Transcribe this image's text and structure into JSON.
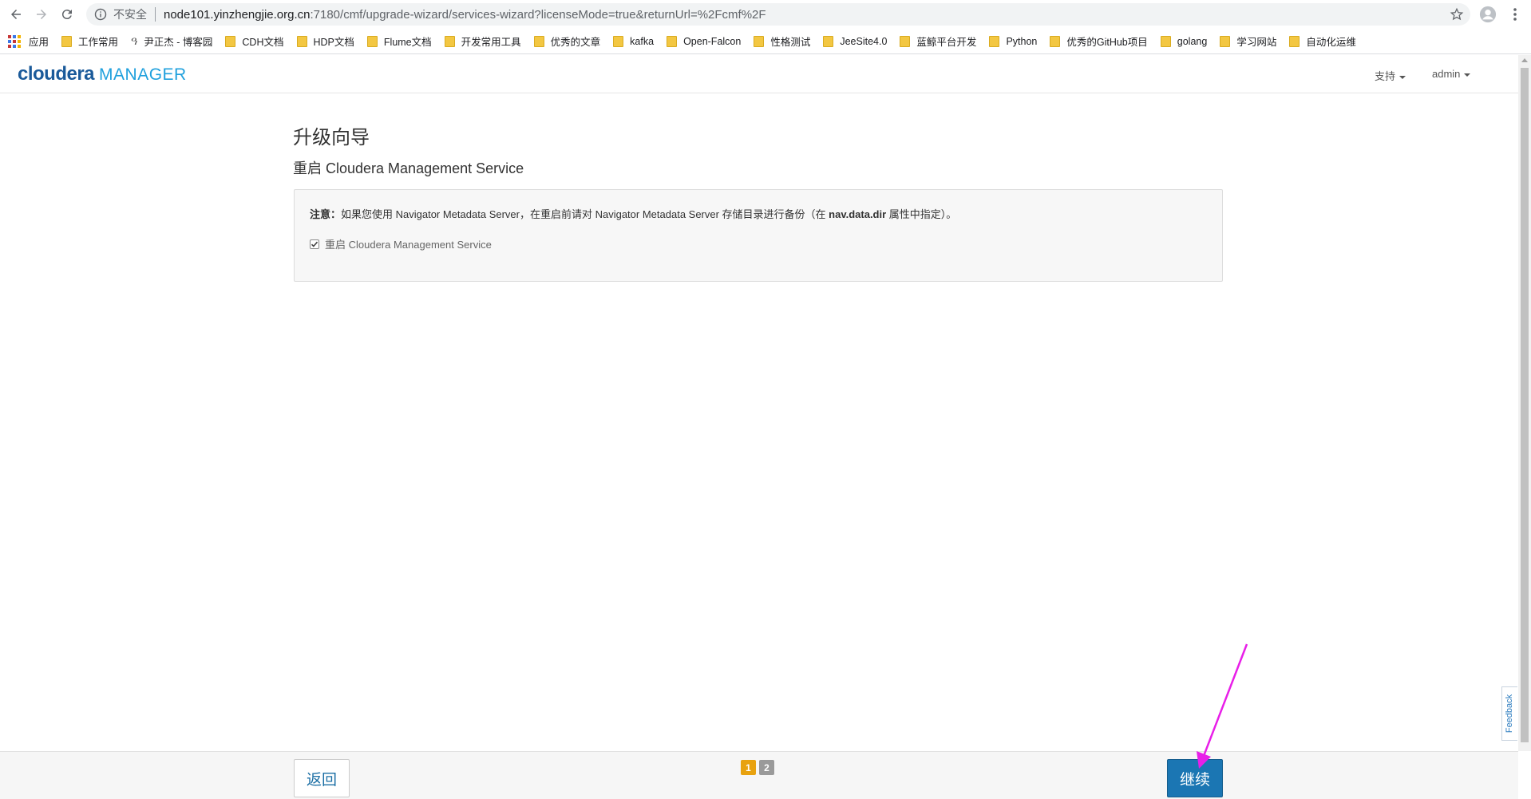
{
  "browser": {
    "security_label": "不安全",
    "url_host": "node101.yinzhengjie.org.cn",
    "url_path": ":7180/cmf/upgrade-wizard/services-wizard?licenseMode=true&returnUrl=%2Fcmf%2F"
  },
  "bookmarks": [
    {
      "label": "应用",
      "icon": "apps-icon"
    },
    {
      "label": "工作常用",
      "icon": "folder-icon"
    },
    {
      "label": "尹正杰 - 博客园",
      "icon": "blog-icon"
    },
    {
      "label": "CDH文档",
      "icon": "folder-icon"
    },
    {
      "label": "HDP文档",
      "icon": "folder-icon"
    },
    {
      "label": "Flume文档",
      "icon": "folder-icon"
    },
    {
      "label": "开发常用工具",
      "icon": "folder-icon"
    },
    {
      "label": "优秀的文章",
      "icon": "folder-icon"
    },
    {
      "label": "kafka",
      "icon": "folder-icon"
    },
    {
      "label": "Open-Falcon",
      "icon": "folder-icon"
    },
    {
      "label": "性格测试",
      "icon": "folder-icon"
    },
    {
      "label": "JeeSite4.0",
      "icon": "folder-icon"
    },
    {
      "label": "蓝鲸平台开发",
      "icon": "folder-icon"
    },
    {
      "label": "Python",
      "icon": "folder-icon"
    },
    {
      "label": "优秀的GitHub项目",
      "icon": "folder-icon"
    },
    {
      "label": "golang",
      "icon": "folder-icon"
    },
    {
      "label": "学习网站",
      "icon": "folder-icon"
    },
    {
      "label": "自动化运维",
      "icon": "folder-icon"
    }
  ],
  "header": {
    "logo_primary": "cloudera",
    "logo_secondary": "MANAGER",
    "support_menu": "支持",
    "user_menu": "admin"
  },
  "main": {
    "title": "升级向导",
    "step_title": "重启 Cloudera Management Service",
    "note_label": "注意：",
    "note_text_1": "如果您使用 Navigator Metadata Server，在重启前请对 Navigator Metadata Server 存储目录进行备份（在 ",
    "note_bold": "nav.data.dir",
    "note_text_2": " 属性中指定）。",
    "checkbox_label": "重启 Cloudera Management Service",
    "checkbox_checked": true
  },
  "feedback_label": "Feedback",
  "footer": {
    "back_label": "返回",
    "pages": [
      "1",
      "2"
    ],
    "current_page": "1",
    "continue_label": "继续"
  },
  "colors": {
    "brand_dark": "#1a5a9a",
    "brand_light": "#1fa0dd",
    "primary_button": "#1b76b3",
    "pager_active": "#e8a20f",
    "annotation_arrow": "#e81fe8"
  }
}
